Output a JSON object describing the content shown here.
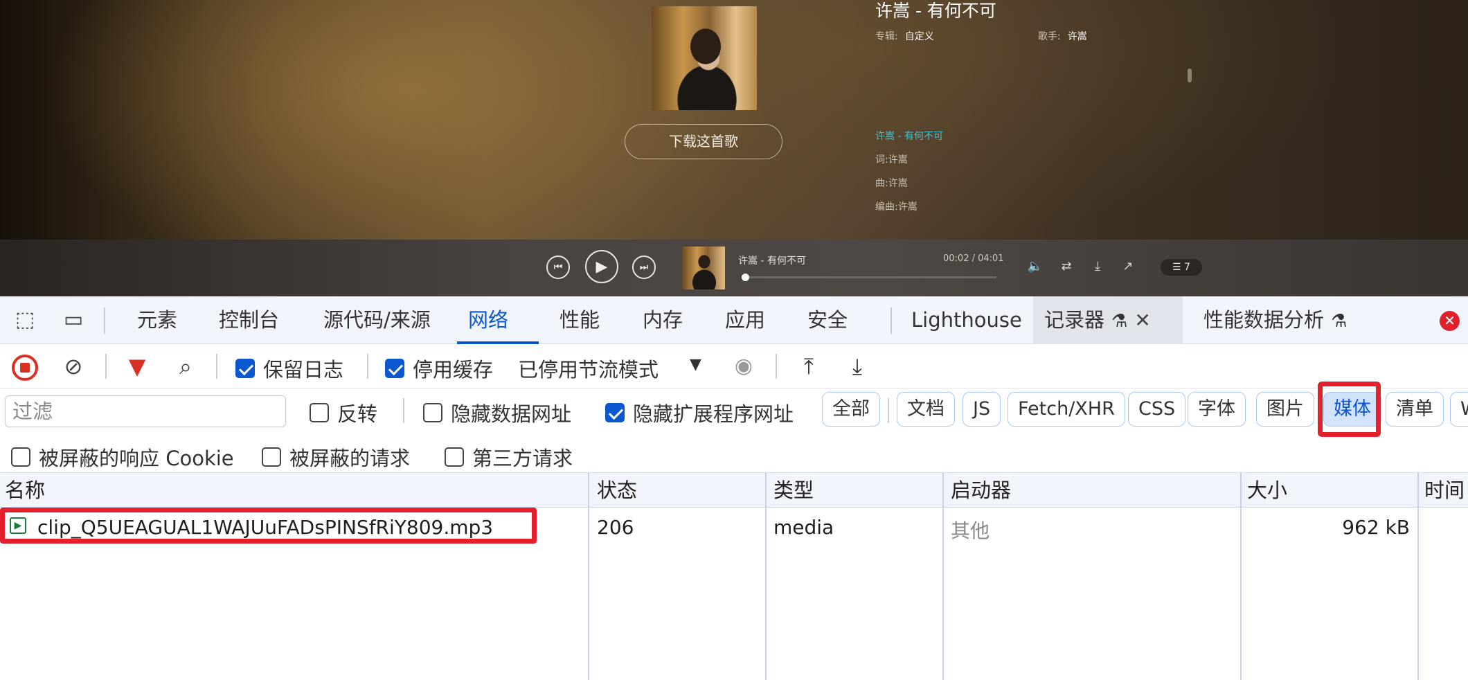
{
  "player": {
    "song_title": "许嵩 - 有何不可",
    "album_label": "专辑:",
    "album_value": "自定义",
    "artist_label": "歌手:",
    "artist_value": "许嵩",
    "download_button": "下载这首歌",
    "lyrics": [
      "许嵩 - 有何不可",
      "词:许嵩",
      "曲:许嵩",
      "编曲:许嵩"
    ],
    "lyric_active_color": "#3fc7d6",
    "bar": {
      "mini_title": "许嵩 - 有何不可",
      "time": "00:02 / 04:01",
      "progress": 0.008,
      "queue_count": "☰ 7"
    }
  },
  "devtools": {
    "tabs": [
      {
        "label": "元素"
      },
      {
        "label": "控制台"
      },
      {
        "label": "源代码/来源"
      },
      {
        "label": "网络",
        "active": true
      },
      {
        "label": "性能"
      },
      {
        "label": "内存"
      },
      {
        "label": "应用"
      },
      {
        "label": "安全"
      },
      {
        "label": "Lighthouse"
      },
      {
        "label": "记录器"
      },
      {
        "label": "性能数据分析"
      }
    ],
    "toolbar": {
      "preserve_log": "保留日志",
      "preserve_log_checked": true,
      "disable_cache": "停用缓存",
      "disable_cache_checked": true,
      "throttling": "已停用节流模式"
    },
    "filter": {
      "placeholder": "过滤",
      "invert": "反转",
      "hide_data_urls": "隐藏数据网址",
      "hide_extension_urls": "隐藏扩展程序网址",
      "hide_extension_urls_checked": true,
      "types": [
        "全部",
        "文档",
        "JS",
        "Fetch/XHR",
        "CSS",
        "字体",
        "图片",
        "媒体",
        "清单",
        "W"
      ],
      "selected_type": "媒体",
      "blocked_cookies": "被屏蔽的响应 Cookie",
      "blocked_requests": "被屏蔽的请求",
      "third_party": "第三方请求"
    },
    "table": {
      "columns": [
        "名称",
        "状态",
        "类型",
        "启动器",
        "大小",
        "时间"
      ],
      "rows": [
        {
          "name": "clip_Q5UEAGUAL1WAJUuFADsPINSfRiY809.mp3",
          "status": "206",
          "type": "media",
          "initiator": "其他",
          "size": "962 kB",
          "time": ""
        }
      ]
    },
    "highlight_color": "#e4202c",
    "accent_color": "#0b57d0"
  }
}
